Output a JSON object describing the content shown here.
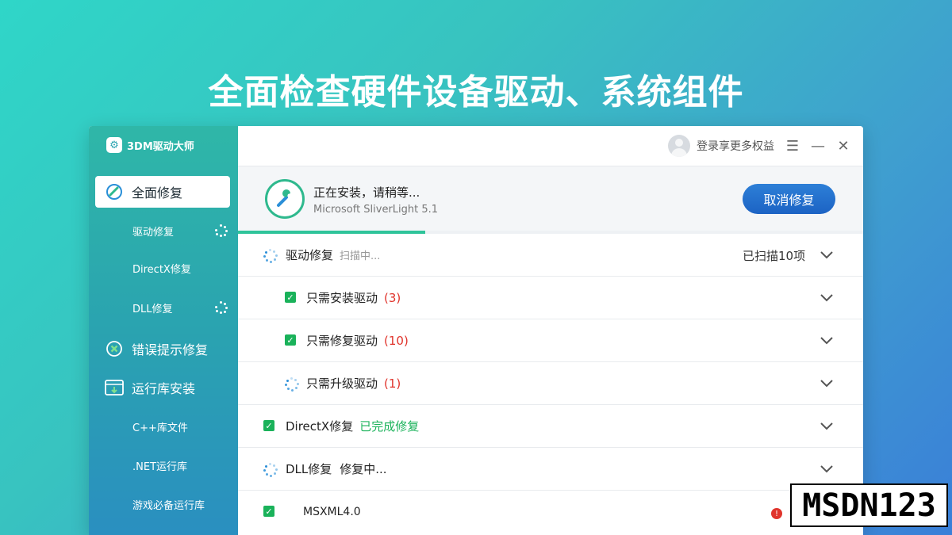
{
  "headline": "全面检查硬件设备驱动、系统组件",
  "app": {
    "name": "3DM驱动大师"
  },
  "titlebar": {
    "login_text": "登录享更多权益",
    "menu_icon": "menu-icon",
    "minimize_icon": "minimize-icon",
    "close_icon": "close-icon"
  },
  "sidebar": {
    "items": [
      {
        "label": "全面修复",
        "icon": "wrench-icon",
        "active": true
      },
      {
        "label": "驱动修复",
        "sub": true,
        "spinner": true
      },
      {
        "label": "DirectX修复",
        "sub": true
      },
      {
        "label": "DLL修复",
        "sub": true,
        "spinner": true
      },
      {
        "label": "错误提示修复",
        "icon": "error-fix-icon"
      },
      {
        "label": "运行库安装",
        "icon": "runtime-install-icon"
      },
      {
        "label": "C++库文件",
        "sub": true
      },
      {
        "label": ".NET运行库",
        "sub": true
      },
      {
        "label": "游戏必备运行库",
        "sub": true
      }
    ]
  },
  "install": {
    "title": "正在安装，请稍等...",
    "subtitle": "Microsoft SliverLight 5.1",
    "cancel_label": "取消修复",
    "progress_percent": 30
  },
  "rows": [
    {
      "label": "驱动修复",
      "status": "扫描中...",
      "right": "已扫描10项",
      "state": "spinner"
    },
    {
      "label": "只需安装驱动",
      "count": "(3)",
      "state": "checked",
      "sub": true
    },
    {
      "label": "只需修复驱动",
      "count": "(10)",
      "state": "checked",
      "sub": true
    },
    {
      "label": "只需升级驱动",
      "count": "(1)",
      "state": "spinner",
      "sub": true
    },
    {
      "label": "DirectX修复",
      "status": "已完成修复",
      "state": "checked"
    },
    {
      "label": "DLL修复",
      "status": "修复中...",
      "state": "spinner"
    },
    {
      "label": "MSXML4.0",
      "state": "checked"
    }
  ],
  "watermark": "MSDN123",
  "colors": {
    "accent": "#2fb7a8",
    "button": "#1c63c4",
    "check": "#1ab25a",
    "count": "#e0342c"
  }
}
